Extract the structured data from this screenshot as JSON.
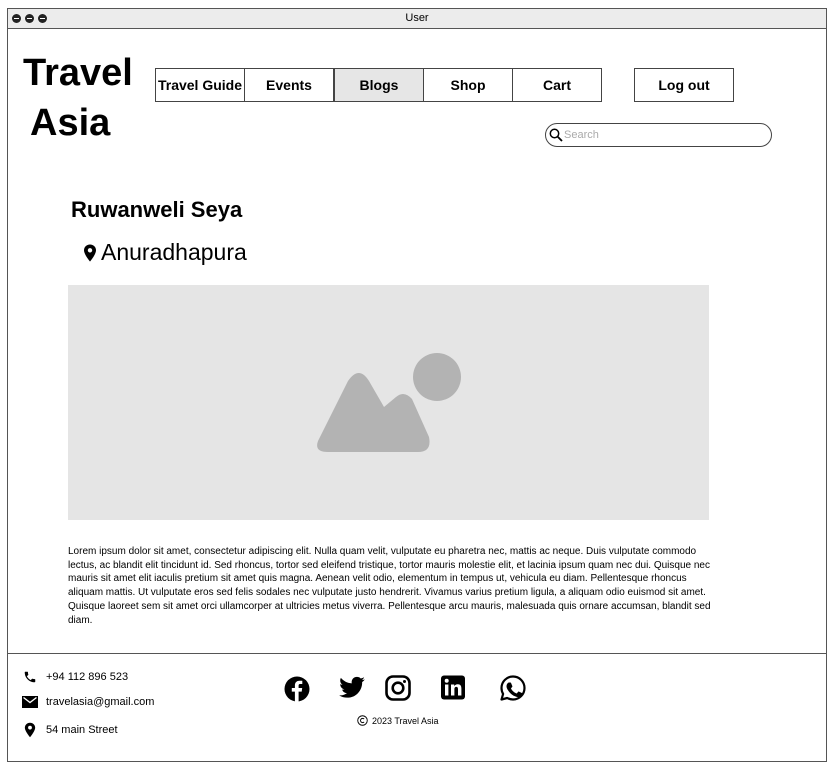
{
  "window": {
    "title": "User"
  },
  "header": {
    "logo_line1": "Travel",
    "logo_line2": "Asia",
    "nav": [
      {
        "label": "Travel Guide"
      },
      {
        "label": "Events"
      },
      {
        "label": "Blogs",
        "active": true
      },
      {
        "label": "Shop"
      },
      {
        "label": "Cart"
      }
    ],
    "logout_label": "Log out",
    "search": {
      "placeholder": "Search",
      "value": ""
    }
  },
  "main": {
    "title": "Ruwanweli Seya",
    "location": "Anuradhapura",
    "image_icon": "image-placeholder-icon",
    "body": "Lorem ipsum dolor sit amet, consectetur adipiscing elit. Nulla quam velit, vulputate eu pharetra nec, mattis ac neque. Duis vulputate commodo lectus, ac blandit elit tincidunt id. Sed rhoncus, tortor sed eleifend tristique, tortor mauris molestie elit, et lacinia ipsum quam nec dui. Quisque nec mauris sit amet elit iaculis pretium sit amet quis magna. Aenean velit odio, elementum in tempus ut, vehicula eu diam. Pellentesque rhoncus aliquam mattis. Ut vulputate eros sed felis sodales nec vulputate justo hendrerit. Vivamus varius pretium ligula, a aliquam odio euismod sit amet. Quisque laoreet sem sit amet orci ullamcorper at ultricies metus viverra. Pellentesque arcu mauris, malesuada quis ornare accumsan, blandit sed diam."
  },
  "footer": {
    "phone": "+94 112 896 523",
    "email": "travelasia@gmail.com",
    "address": "54 main Street",
    "social_icons": [
      "facebook-icon",
      "twitter-icon",
      "instagram-icon",
      "linkedin-icon",
      "whatsapp-icon"
    ],
    "copyright": "2023 Travel Asia"
  }
}
